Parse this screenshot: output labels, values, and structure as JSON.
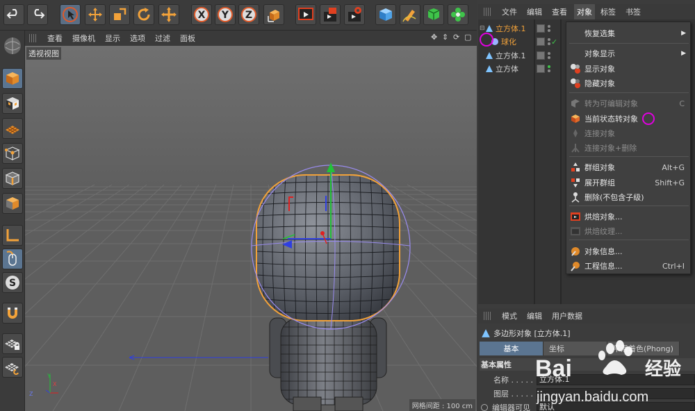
{
  "colors": {
    "accent": "#5b7591",
    "selection_orange": "#f2a23a",
    "highlight_magenta": "#e000e0",
    "axis_green": "#22c23a",
    "axis_red": "#e02020",
    "axis_blue": "#2f3fe0"
  },
  "toolbar": {
    "buttons": [
      "undo-icon",
      "redo-icon",
      "select-arrow-icon",
      "move-icon",
      "scale-icon",
      "rotate-icon",
      "move-alt-icon",
      "x-axis-icon",
      "y-axis-icon",
      "z-axis-icon",
      "world-coord-icon",
      "render-view-icon",
      "render-picture-icon",
      "render-settings-icon",
      "cube-icon",
      "pen-icon",
      "subdivision-icon",
      "flower-icon"
    ],
    "axis_letters": [
      "X",
      "Y",
      "Z"
    ]
  },
  "viewport": {
    "menu": [
      "查看",
      "摄像机",
      "显示",
      "选项",
      "过滤",
      "面板"
    ],
    "label": "透视视图",
    "grid_spacing": "网格间距 : 100 cm"
  },
  "object_manager": {
    "menu": [
      "文件",
      "编辑",
      "查看",
      "对象",
      "标签",
      "书签"
    ],
    "open_menu": "对象",
    "objects": [
      {
        "name": "立方体.1",
        "color": "#f2a23a",
        "indent": 0
      },
      {
        "name": "球化",
        "color": "#f2a23a",
        "indent": 1
      },
      {
        "name": "立方体.1",
        "color": "#d8d8d8",
        "indent": 0
      },
      {
        "name": "立方体",
        "color": "#d8d8d8",
        "indent": 0
      }
    ]
  },
  "dropdown": {
    "items": [
      {
        "label": "恢复选集",
        "submenu": true,
        "disabled": false,
        "shortcut": ""
      },
      {
        "label": "对象显示",
        "submenu": true,
        "disabled": false,
        "shortcut": ""
      },
      {
        "label": "显示对象",
        "submenu": false,
        "disabled": false,
        "shortcut": ""
      },
      {
        "label": "隐藏对象",
        "submenu": false,
        "disabled": false,
        "shortcut": ""
      },
      {
        "label": "转为可编辑对象",
        "submenu": false,
        "disabled": true,
        "shortcut": "C"
      },
      {
        "label": "当前状态转对象",
        "submenu": false,
        "disabled": false,
        "shortcut": ""
      },
      {
        "label": "连接对象",
        "submenu": false,
        "disabled": true,
        "shortcut": ""
      },
      {
        "label": "连接对象+删除",
        "submenu": false,
        "disabled": true,
        "shortcut": ""
      },
      {
        "label": "群组对象",
        "submenu": false,
        "disabled": false,
        "shortcut": "Alt+G"
      },
      {
        "label": "展开群组",
        "submenu": false,
        "disabled": false,
        "shortcut": "Shift+G"
      },
      {
        "label": "删除(不包含子级)",
        "submenu": false,
        "disabled": false,
        "shortcut": ""
      },
      {
        "label": "烘焙对象...",
        "submenu": false,
        "disabled": false,
        "shortcut": ""
      },
      {
        "label": "烘焙纹理...",
        "submenu": false,
        "disabled": true,
        "shortcut": ""
      },
      {
        "label": "对象信息...",
        "submenu": false,
        "disabled": false,
        "shortcut": ""
      },
      {
        "label": "工程信息...",
        "submenu": false,
        "disabled": false,
        "shortcut": "Ctrl+I"
      }
    ]
  },
  "attributes": {
    "menu": [
      "模式",
      "编辑",
      "用户数据"
    ],
    "title": "多边形对象 [立方体.1]",
    "tabs": [
      "基本",
      "坐标",
      "平滑着色(Phong)"
    ],
    "section": "基本属性",
    "fields": [
      {
        "label": "名称 . . . . .",
        "value": "立方体.1"
      },
      {
        "label": "图层 . . . . .",
        "value": ""
      },
      {
        "label": "编辑器可见",
        "value": "默认"
      }
    ]
  },
  "watermark": {
    "brand": "Bai",
    "brand_cn": "经验",
    "url": "jingyan.baidu.com"
  }
}
